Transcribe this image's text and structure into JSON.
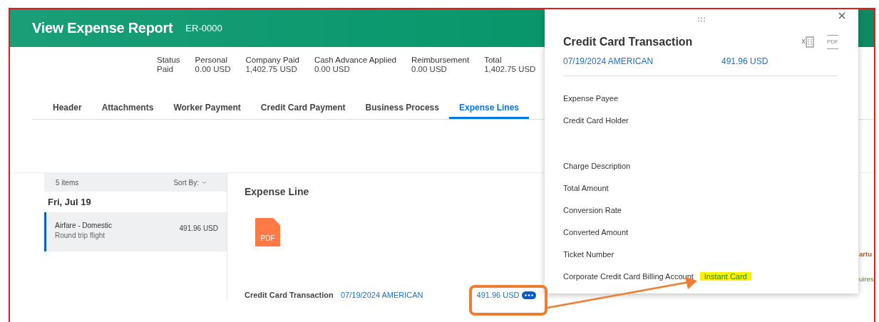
{
  "header": {
    "title": "View Expense Report",
    "report_id": "ER-0000"
  },
  "summary": [
    {
      "label": "Status",
      "value": "Paid"
    },
    {
      "label": "Personal",
      "value": "0.00 USD"
    },
    {
      "label": "Company Paid",
      "value": "1,402.75 USD"
    },
    {
      "label": "Cash Advance Applied",
      "value": "0.00 USD"
    },
    {
      "label": "Reimbursement",
      "value": "0.00 USD"
    },
    {
      "label": "Total",
      "value": "1,402.75 USD"
    }
  ],
  "tabs": [
    {
      "label": "Header",
      "selected": false
    },
    {
      "label": "Attachments",
      "selected": false
    },
    {
      "label": "Worker Payment",
      "selected": false
    },
    {
      "label": "Credit Card Payment",
      "selected": false
    },
    {
      "label": "Business Process",
      "selected": false
    },
    {
      "label": "Expense Lines",
      "selected": true
    }
  ],
  "expense_list": {
    "count": "5 items",
    "sort_label": "Sort By:",
    "date_group": "Fri, Jul 19",
    "items": [
      {
        "title": "Airfare - Domestic",
        "subtitle": "Round trip flight",
        "amount": "491.96 USD",
        "selected": true
      }
    ]
  },
  "expense_line": {
    "title": "Expense Line",
    "attachment": {
      "label": "PDF"
    },
    "transaction_label": "Credit Card Transaction",
    "transaction": "07/19/2024 AMERICAN",
    "amount": "491.96 USD"
  },
  "edge_fragments": [
    {
      "text": "artu",
      "kind": "warning"
    },
    {
      "text": "uires",
      "kind": "note"
    }
  ],
  "popup": {
    "title": "Credit Card Transaction",
    "pdf_export_label": "PDF",
    "transaction": "07/19/2024 AMERICAN",
    "amount": "491.96 USD",
    "holder_fields": [
      {
        "label": "Expense Payee"
      },
      {
        "label": "Credit Card Holder"
      }
    ],
    "charge_fields": [
      {
        "label": "Charge Description"
      },
      {
        "label": "Total Amount"
      },
      {
        "label": "Conversion Rate"
      },
      {
        "label": "Converted Amount"
      },
      {
        "label": "Ticket Number"
      },
      {
        "label": "Corporate Credit Card Billing Account",
        "value": "Instant Card",
        "highlighted": true
      }
    ]
  }
}
